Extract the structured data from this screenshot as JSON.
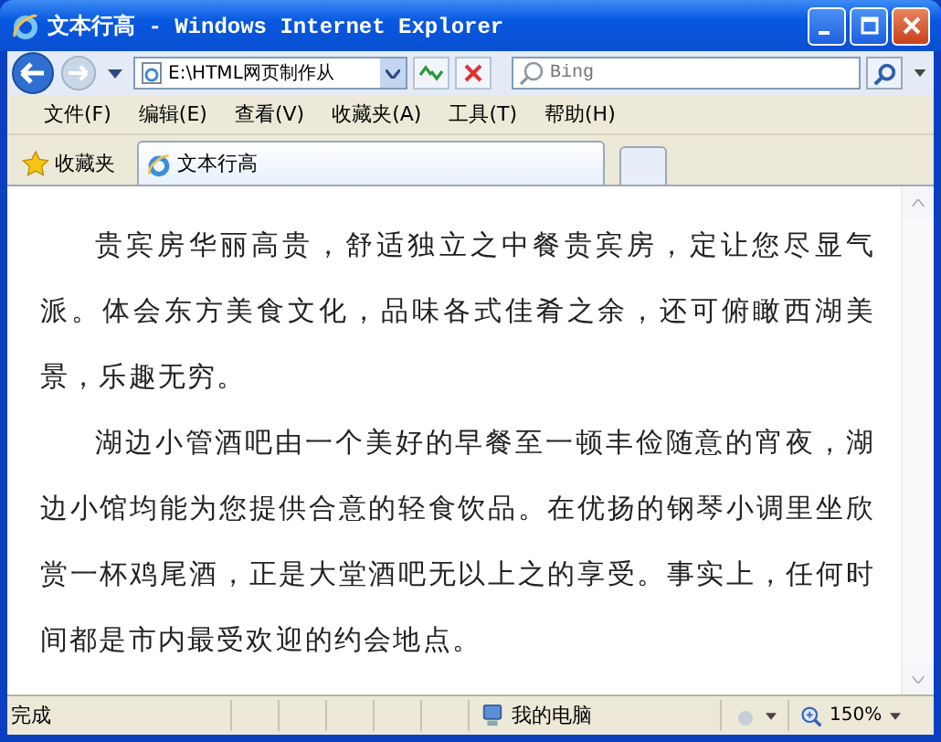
{
  "window": {
    "title": "文本行高 - Windows Internet Explorer"
  },
  "address_bar": {
    "value": "E:\\HTML网页制作从"
  },
  "search": {
    "placeholder": "Bing"
  },
  "menu": [
    "文件(F)",
    "编辑(E)",
    "查看(V)",
    "收藏夹(A)",
    "工具(T)",
    "帮助(H)"
  ],
  "favorites": {
    "label": "收藏夹"
  },
  "tabs": [
    {
      "label": "文本行高",
      "selected": true
    }
  ],
  "paragraphs": [
    "贵宾房华丽高贵，舒适独立之中餐贵宾房，定让您尽显气派。体会东方美食文化，品味各式佳肴之余，还可俯瞰西湖美景，乐趣无穷。",
    "湖边小管酒吧由一个美好的早餐至一顿丰俭随意的宵夜，湖边小馆均能为您提供合意的轻食饮品。在优扬的钢琴小调里坐欣赏一杯鸡尾酒，正是大堂酒吧无以上之的享受。事实上，任何时间都是市内最受欢迎的约会地点。"
  ],
  "status_bar": {
    "text": "完成",
    "zone": "我的电脑",
    "zoom": "150%"
  }
}
